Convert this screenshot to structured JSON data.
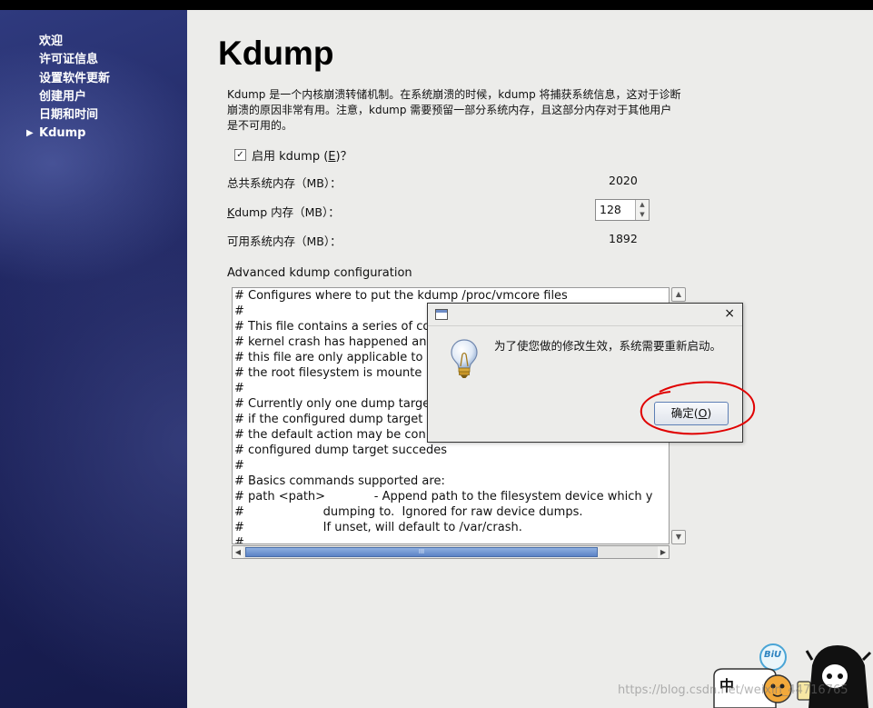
{
  "sidebar": {
    "items": [
      {
        "label": "欢迎"
      },
      {
        "label": "许可证信息"
      },
      {
        "label": "设置软件更新"
      },
      {
        "label": "创建用户"
      },
      {
        "label": "日期和时间"
      },
      {
        "label": "Kdump",
        "current": true
      }
    ]
  },
  "page": {
    "title": "Kdump",
    "intro": "Kdump 是一个内核崩溃转储机制。在系统崩溃的时候，kdump 将捕获系统信息，这对于诊断崩溃的原因非常有用。注意，kdump 需要预留一部分系统内存，且这部分内存对于其他用户是不可用的。",
    "enable": {
      "prefix": "启用 kdump (",
      "mnemonic": "E",
      "suffix": ")？",
      "checked": true
    },
    "total_mem": {
      "label": "总共系统内存（MB）：",
      "value": "2020"
    },
    "kdump_mem": {
      "mnemonic": "K",
      "label_rest": "dump 内存（MB）：",
      "value": "128"
    },
    "avail_mem": {
      "label": "可用系统内存（MB）：",
      "value": "1892"
    },
    "advanced_label": "Advanced kdump configuration",
    "config_lines": [
      "# Configures where to put the kdump /proc/vmcore files",
      "#",
      "# This file contains a series of co",
      "# kernel crash has happened an",
      "# this file are only applicable to",
      "# the root filesystem is mounte",
      "#",
      "# Currently only one dump targe",
      "# if the configured dump target",
      "# the default action may be con",
      "# configured dump target succedes",
      "#",
      "# Basics commands supported are:",
      "# path <path>             - Append path to the filesystem device which y",
      "#                     dumping to.  Ignored for raw device dumps.",
      "#                     If unset, will default to /var/crash.",
      "#"
    ],
    "hscroll_grip": "III"
  },
  "dialog": {
    "message": "为了使您做的修改生效，系统需要重新启动。",
    "close_glyph": "×",
    "ok": {
      "prefix": "确定(",
      "mnemonic": "O",
      "suffix": ")"
    }
  },
  "overlay": {
    "watermark": "https://blog.csdn.net/weixin_44716765",
    "sticker_bubble": "BiU",
    "sticker_text": "中"
  },
  "colors": {
    "sidebar": "#1d235c",
    "annotation_circle": "#e00000",
    "scroll_thumb": "#5b83c5"
  }
}
